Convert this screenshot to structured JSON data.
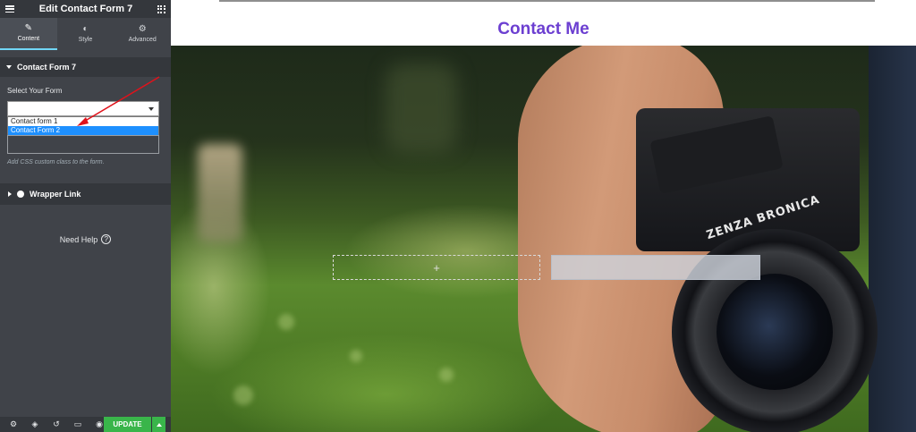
{
  "app": {
    "title": "Edit Contact Form 7"
  },
  "tabs": [
    {
      "label": "Content",
      "icon": "pencil-icon"
    },
    {
      "label": "Style",
      "icon": "contrast-icon"
    },
    {
      "label": "Advanced",
      "icon": "gear-icon"
    }
  ],
  "section": {
    "title": "Contact Form 7",
    "select_label": "Select Your Form",
    "select_value": "",
    "options": [
      "Contact form 1",
      "Contact Form 2"
    ],
    "selected_option": "Contact Form 2",
    "hint": "Add CSS custom class to the form."
  },
  "wrapper": {
    "title": "Wrapper Link"
  },
  "help": {
    "label": "Need Help",
    "icon": "?"
  },
  "footer": {
    "update_label": "UPDATE",
    "icons": [
      "settings-icon",
      "layers-icon",
      "history-icon",
      "responsive-icon",
      "preview-icon"
    ]
  },
  "canvas": {
    "heading": "Contact Me",
    "placeholder_icon": "+",
    "camera_brand": "ZENZA BRONICA"
  },
  "colors": {
    "panel": "#404349",
    "accent_tab": "#71d7f7",
    "update_green": "#39b54a",
    "heading_purple": "#6c3fd1",
    "selected_option": "#1e90ff"
  }
}
